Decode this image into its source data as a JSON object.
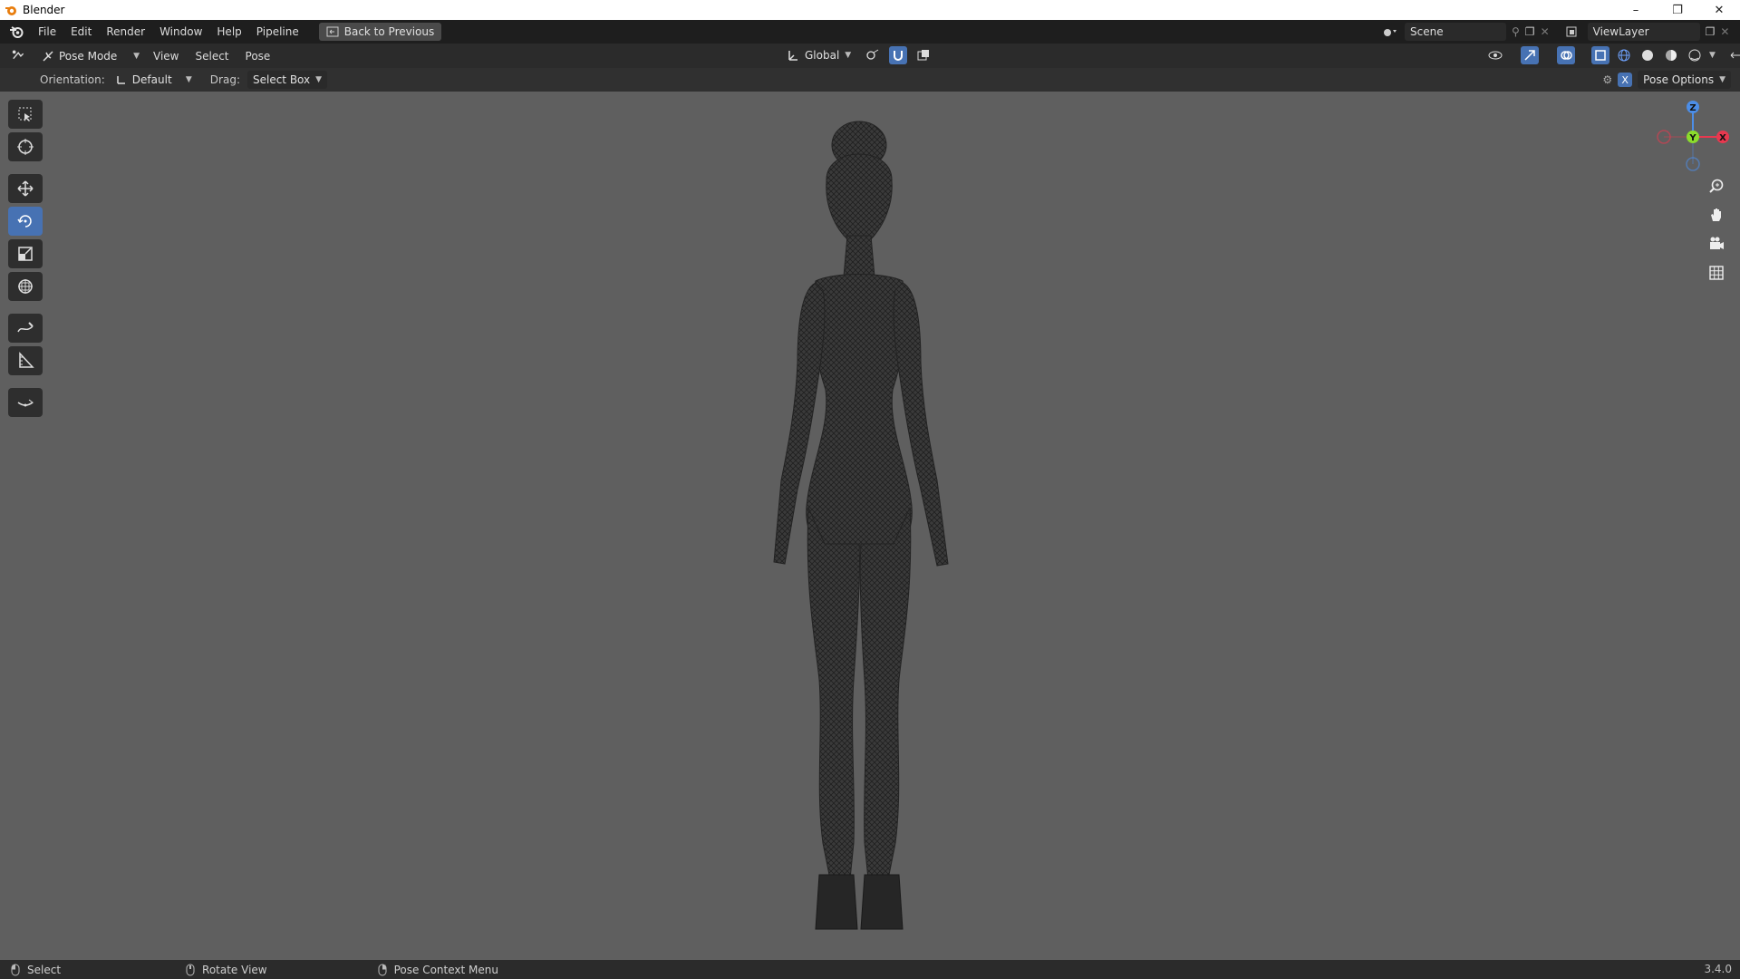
{
  "window": {
    "title": "Blender"
  },
  "menubar": {
    "items": [
      "File",
      "Edit",
      "Render",
      "Window",
      "Help",
      "Pipeline"
    ],
    "back_button": "Back to Previous",
    "scene": "Scene",
    "view_layer": "ViewLayer"
  },
  "header": {
    "mode": "Pose Mode",
    "menus": [
      "View",
      "Select",
      "Pose"
    ],
    "transform_orientation": "Global"
  },
  "tool_settings": {
    "orientation_label": "Orientation:",
    "orientation_value": "Default",
    "drag_label": "Drag:",
    "drag_value": "Select Box",
    "pose_options": "Pose Options"
  },
  "gizmo": {
    "z": "Z",
    "y": "Y",
    "x": "X"
  },
  "statusbar": {
    "select": "Select",
    "rotate": "Rotate View",
    "context": "Pose Context Menu",
    "version": "3.4.0"
  },
  "colors": {
    "viewport_bg": "#5f5f5f",
    "active_tool": "#4772b3",
    "axis_x": "#e8384f",
    "axis_y": "#8bdc2c",
    "axis_z": "#4c8ee8",
    "mesh": "#2a2a2a"
  },
  "icons": {
    "app": "blender-icon",
    "toolbar": [
      "select-box-icon",
      "cursor-icon",
      "move-icon",
      "rotate-icon",
      "scale-icon",
      "transform-icon",
      "annotate-icon",
      "measure-icon",
      "bone-roll-icon"
    ],
    "nav": [
      "zoom-icon",
      "pan-hand-icon",
      "camera-icon",
      "grid-icon"
    ]
  }
}
